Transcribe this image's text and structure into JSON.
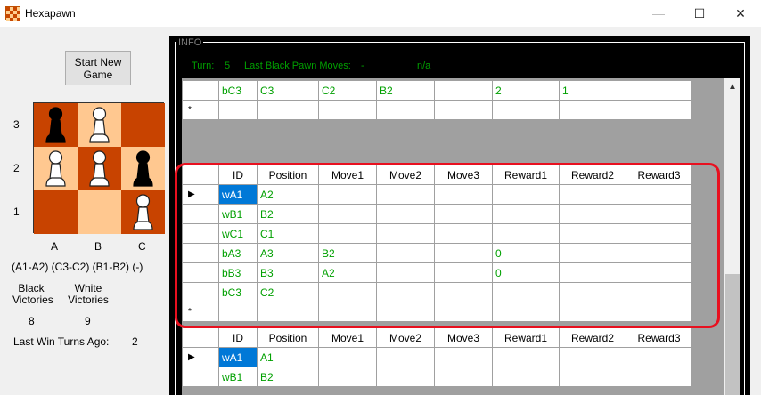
{
  "window": {
    "title": "Hexapawn",
    "minimize": "—",
    "maximize": "☐",
    "close": "✕"
  },
  "left": {
    "start_button": "Start New Game",
    "ranks": [
      "3",
      "2",
      "1"
    ],
    "files": [
      "A",
      "B",
      "C"
    ],
    "moves_text": "(A1-A2) (C3-C2) (B1-B2) (-)",
    "black_victories_label": "Black Victories",
    "white_victories_label": "White Victories",
    "black_victories": "8",
    "white_victories": "9",
    "last_win_label": "Last Win Turns Ago:",
    "last_win_value": "2"
  },
  "board": [
    [
      "black",
      "white",
      ""
    ],
    [
      "white",
      "white",
      "black"
    ],
    [
      "",
      "",
      "white"
    ]
  ],
  "colors": {
    "dark_square": "#c84300",
    "light_square": "#ffc890",
    "text_green": "#00a000",
    "highlight": "#e8101f",
    "selected": "#0078d7"
  },
  "info": {
    "legend": "INFO",
    "turn_label": "Turn:",
    "turn_value": "5",
    "last_moves_label": "Last Black Pawn Moves:",
    "last_moves_value": "-",
    "na": "n/a"
  },
  "columns": [
    "ID",
    "Position",
    "Move1",
    "Move2",
    "Move3",
    "Reward1",
    "Reward2",
    "Reward3"
  ],
  "grid_top": {
    "rows": [
      {
        "marker": "",
        "cells": [
          "bC3",
          "C3",
          "C2",
          "B2",
          "",
          "2",
          "1",
          ""
        ]
      },
      {
        "marker": "*",
        "cells": [
          "",
          "",
          "",
          "",
          "",
          "",
          "",
          ""
        ]
      }
    ]
  },
  "grid_mid": {
    "rows": [
      {
        "marker": "▶",
        "cells": [
          "wA1",
          "A2",
          "",
          "",
          "",
          "",
          "",
          ""
        ]
      },
      {
        "marker": "",
        "cells": [
          "wB1",
          "B2",
          "",
          "",
          "",
          "",
          "",
          ""
        ]
      },
      {
        "marker": "",
        "cells": [
          "wC1",
          "C1",
          "",
          "",
          "",
          "",
          "",
          ""
        ]
      },
      {
        "marker": "",
        "cells": [
          "bA3",
          "A3",
          "B2",
          "",
          "",
          "0",
          "",
          ""
        ]
      },
      {
        "marker": "",
        "cells": [
          "bB3",
          "B3",
          "A2",
          "",
          "",
          "0",
          "",
          ""
        ]
      },
      {
        "marker": "",
        "cells": [
          "bC3",
          "C2",
          "",
          "",
          "",
          "",
          "",
          ""
        ]
      },
      {
        "marker": "*",
        "cells": [
          "",
          "",
          "",
          "",
          "",
          "",
          "",
          ""
        ]
      }
    ]
  },
  "grid_bottom": {
    "rows": [
      {
        "marker": "▶",
        "cells": [
          "wA1",
          "A1",
          "",
          "",
          "",
          "",
          "",
          ""
        ]
      },
      {
        "marker": "",
        "cells": [
          "wB1",
          "B2",
          "",
          "",
          "",
          "",
          "",
          ""
        ]
      }
    ]
  }
}
